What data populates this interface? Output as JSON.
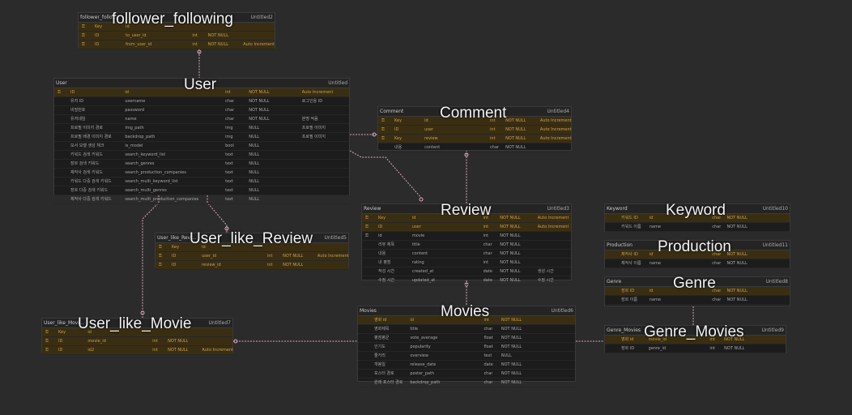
{
  "colors": {
    "background": "#2b2b2b",
    "table_bg": "#1c1c1c",
    "key_row": "#3a2e12",
    "relation": "#d9a7b5"
  },
  "row_headers": [
    "Key",
    "id"
  ],
  "tables": {
    "follower_following": {
      "name": "follower_follo...",
      "title": "follower_following",
      "untitled": "Untitled2",
      "rows": [
        [
          "Key",
          "id",
          "",
          "",
          ""
        ],
        [
          "ID",
          "to_user_id",
          "int",
          "NOT NULL",
          ""
        ],
        [
          "ID",
          "from_user_id",
          "int",
          "NOT NULL",
          "Auto Increment"
        ]
      ]
    },
    "user": {
      "name": "User",
      "title": "User",
      "untitled": "Untitled",
      "rows": [
        [
          "ID",
          "id",
          "int",
          "NOT NULL",
          "Auto Increment"
        ],
        [
          "유저 ID",
          "username",
          "char",
          "NOT NULL",
          "로그인용 ID"
        ],
        [
          "비밀번호",
          "password",
          "char",
          "NOT NULL",
          ""
        ],
        [
          "유저네임",
          "name",
          "char",
          "NOT NULL",
          "본명 적음"
        ],
        [
          "프로필 이미지 경로",
          "img_path",
          "img",
          "NULL",
          "프로필 이미지"
        ],
        [
          "프로필 배경 이미지 경로",
          "backdrop_path",
          "img",
          "NULL",
          "프로필 이미지"
        ],
        [
          "모서 모델 생성 체크",
          "is_model",
          "bool",
          "NULL",
          ""
        ],
        [
          "키워드 검색 키워드",
          "search_keyword_list",
          "text",
          "NULL",
          ""
        ],
        [
          "장르 검색 키워드",
          "search_genres",
          "text",
          "NULL",
          ""
        ],
        [
          "제작사 검색 키워드",
          "search_production_companies",
          "text",
          "NULL",
          ""
        ],
        [
          "키워드 다중 검색 키워드",
          "search_multi_keyword_list",
          "text",
          "NULL",
          ""
        ],
        [
          "장르 다중 검색 키워드",
          "search_multi_genres",
          "text",
          "NULL",
          ""
        ],
        [
          "제작사 다중 검색 키워드",
          "search_multi_production_companies",
          "text",
          "NULL",
          ""
        ]
      ]
    },
    "comment": {
      "name": "Comment",
      "title": "Comment",
      "untitled": "Untitled4",
      "rows": [
        [
          "Key",
          "id",
          "int",
          "NOT NULL",
          "Auto Increment"
        ],
        [
          "ID",
          "user",
          "int",
          "NOT NULL",
          "Auto Increment"
        ],
        [
          "Key",
          "review",
          "int",
          "NOT NULL",
          "Auto Increment"
        ],
        [
          "내용",
          "content",
          "char",
          "NOT NULL",
          ""
        ]
      ]
    },
    "review": {
      "name": "Review",
      "title": "Review",
      "untitled": "Untitled3",
      "rows": [
        [
          "Key",
          "id",
          "int",
          "NOT NULL",
          "Auto Increment"
        ],
        [
          "ID",
          "user",
          "int",
          "NOT NULL",
          "Auto Increment"
        ],
        [
          "id",
          "movie",
          "int",
          "NOT NULL",
          ""
        ],
        [
          "리뷰 제목",
          "title",
          "char",
          "NOT NULL",
          ""
        ],
        [
          "내용",
          "content",
          "char",
          "NOT NULL",
          ""
        ],
        [
          "내 평점",
          "rating",
          "int",
          "NOT NULL",
          ""
        ],
        [
          "작성 시간",
          "created_at",
          "date",
          "NOT NULL",
          "생성 시간"
        ],
        [
          "수정 시간",
          "updated_at",
          "date",
          "NOT NULL",
          "수정 시간"
        ]
      ]
    },
    "user_like_review": {
      "name": "User_like_Revi...",
      "title": "User_like_Review",
      "untitled": "Untitled5",
      "rows": [
        [
          "Key",
          "id",
          "",
          "",
          ""
        ],
        [
          "ID",
          "user_id",
          "int",
          "NOT NULL",
          "Auto Increment"
        ],
        [
          "ID",
          "review_id",
          "int",
          "NOT NULL",
          ""
        ]
      ]
    },
    "keyword": {
      "name": "Keyword",
      "title": "Keyword",
      "untitled": "Untitled10",
      "rows": [
        [
          "키워드 ID",
          "id",
          "char",
          "NOT NULL",
          ""
        ],
        [
          "키워드 이름",
          "name",
          "char",
          "NOT NULL",
          ""
        ]
      ]
    },
    "production": {
      "name": "Production",
      "title": "Production",
      "untitled": "Untitled11",
      "rows": [
        [
          "제작사 ID",
          "id",
          "char",
          "NOT NULL",
          ""
        ],
        [
          "제작사 이름",
          "name",
          "char",
          "NOT NULL",
          ""
        ]
      ]
    },
    "genre": {
      "name": "Genre",
      "title": "Genre",
      "untitled": "Untitled8",
      "rows": [
        [
          "장르 ID",
          "id",
          "char",
          "NOT NULL",
          ""
        ],
        [
          "장르 이름",
          "name",
          "char",
          "NOT NULL",
          ""
        ]
      ]
    },
    "user_like_movie": {
      "name": "User_like_Movi...",
      "title": "User_like_Movie",
      "untitled": "Untitled7",
      "rows": [
        [
          "Key",
          "id",
          "",
          "",
          ""
        ],
        [
          "ID",
          "movie_id",
          "int",
          "NOT NULL",
          ""
        ],
        [
          "ID",
          "id2",
          "int",
          "NOT NULL",
          "Auto Increment"
        ]
      ]
    },
    "movies": {
      "name": "Movies",
      "title": "Movies",
      "untitled": "Untitled6",
      "rows": [
        [
          "영화 id",
          "id",
          "int",
          "NOT NULL",
          ""
        ],
        [
          "영화제목",
          "title",
          "char",
          "NOT NULL",
          ""
        ],
        [
          "평점평균",
          "vote_average",
          "float",
          "NOT NULL",
          ""
        ],
        [
          "인기도",
          "popularity",
          "float",
          "NOT NULL",
          ""
        ],
        [
          "줄거리",
          "overview",
          "text",
          "NULL",
          ""
        ],
        [
          "개봉일",
          "release_date",
          "date",
          "NOT NULL",
          ""
        ],
        [
          "포스터 경로",
          "poster_path",
          "char",
          "NOT NULL",
          ""
        ],
        [
          "원래 포스터 경로",
          "backdrop_path",
          "char",
          "NOT NULL",
          ""
        ]
      ]
    },
    "genre_movies": {
      "name": "Genre_Movies",
      "title": "Genre_Movies",
      "untitled": "Untitled9",
      "rows": [
        [
          "영화 id",
          "movie_id",
          "int",
          "NOT NULL",
          ""
        ],
        [
          "장르 ID",
          "genre_id",
          "int",
          "NOT NULL",
          ""
        ]
      ]
    }
  }
}
